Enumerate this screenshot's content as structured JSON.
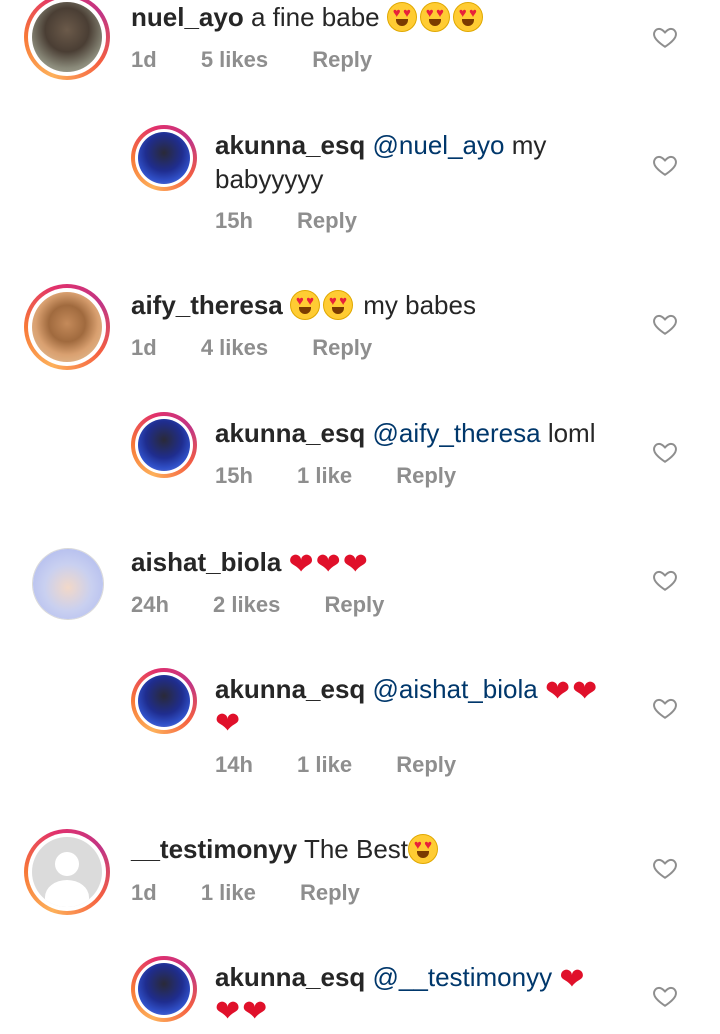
{
  "comments": [
    {
      "username": "nuel_ayo",
      "text": "a fine babe",
      "emoji": [
        "heart-eyes-emoji",
        "heart-eyes-emoji",
        "heart-eyes-emoji"
      ],
      "time": "1d",
      "likes": "5 likes",
      "reply": "Reply",
      "reply_comment": {
        "username": "akunna_esq",
        "mention": "@nuel_ayo",
        "text_line1": "my",
        "text_line2": "babyyyyy",
        "time": "15h",
        "likes": "",
        "reply": "Reply"
      }
    },
    {
      "username": "aify_theresa",
      "text": "my babes",
      "emoji": [
        "heart-eyes-emoji",
        "heart-eyes-emoji"
      ],
      "time": "1d",
      "likes": "4 likes",
      "reply": "Reply",
      "reply_comment": {
        "username": "akunna_esq",
        "mention": "@aify_theresa",
        "text_line1": "loml",
        "time": "15h",
        "likes": "1 like",
        "reply": "Reply"
      }
    },
    {
      "username": "aishat_biola",
      "text": "",
      "emoji": [
        "red-heart-emoji",
        "red-heart-emoji",
        "red-heart-emoji"
      ],
      "time": "24h",
      "likes": "2 likes",
      "reply": "Reply",
      "reply_comment": {
        "username": "akunna_esq",
        "mention": "@aishat_biola",
        "text_line1": "",
        "time": "14h",
        "likes": "1 like",
        "reply": "Reply"
      }
    },
    {
      "username": "__testimonyy",
      "text": "The Best",
      "emoji": [
        "heart-eyes-emoji"
      ],
      "time": "1d",
      "likes": "1 like",
      "reply": "Reply",
      "reply_comment": {
        "username": "akunna_esq",
        "mention": "@__testimonyy",
        "text_line1": ""
      }
    }
  ],
  "colors": {
    "username": "#262626",
    "mention": "#00376b",
    "meta": "#8e8e8e",
    "heart_emoji": "#e0102a"
  },
  "icons": {
    "like": "heart-outline-icon"
  }
}
